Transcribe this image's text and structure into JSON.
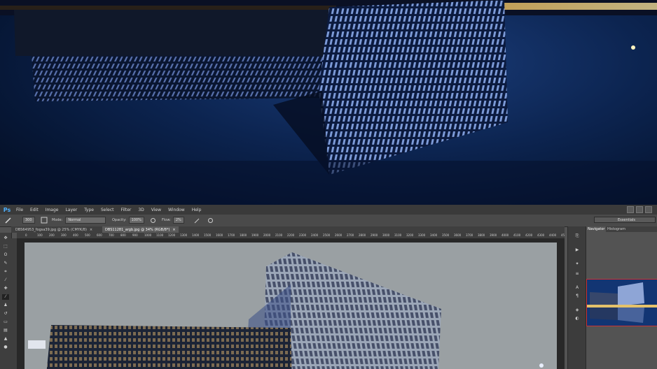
{
  "app": {
    "logo": "Ps",
    "menu": [
      "File",
      "Edit",
      "Image",
      "Layer",
      "Type",
      "Select",
      "Filter",
      "3D",
      "View",
      "Window",
      "Help"
    ]
  },
  "options_bar": {
    "brush_size": "300",
    "mode_label": "Mode:",
    "mode_value": "Normal",
    "opacity_label": "Opacity:",
    "opacity_value": "100%",
    "flow_label": "Flow:",
    "flow_value": "2%",
    "workspace": "Essentials"
  },
  "documents": {
    "tabs": [
      {
        "label": "DBS64953_fogsa39.jpg @ 25% (CMYK/8)",
        "active": false
      },
      {
        "label": "DBS11281_argb.jpg @ 34% (RGB/8*)",
        "active": true
      }
    ]
  },
  "ruler": {
    "ticks": [
      "0",
      "100",
      "200",
      "300",
      "400",
      "500",
      "600",
      "700",
      "800",
      "900",
      "1000",
      "1100",
      "1200",
      "1300",
      "1400",
      "1500",
      "1600",
      "1700",
      "1800",
      "1900",
      "2000",
      "2100",
      "2200",
      "2300",
      "2400",
      "2500",
      "2600",
      "2700",
      "2800",
      "2900",
      "3000",
      "3100",
      "3200",
      "3300",
      "3400",
      "3500",
      "3600",
      "3700",
      "3800",
      "3900",
      "4000",
      "4100",
      "4200",
      "4300",
      "4400",
      "4500"
    ]
  },
  "panels": {
    "tabs": [
      "Navigator",
      "Histogram"
    ]
  },
  "icons": {
    "tools": [
      "move-tool-icon",
      "marquee-tool-icon",
      "lasso-tool-icon",
      "quick-select-tool-icon",
      "crop-tool-icon",
      "eyedropper-tool-icon",
      "healing-brush-icon",
      "brush-tool-icon",
      "clone-stamp-icon",
      "history-brush-icon",
      "eraser-tool-icon",
      "gradient-tool-icon",
      "blur-tool-icon",
      "dodge-tool-icon"
    ],
    "dock": [
      "history-panel-icon",
      "actions-panel-icon",
      "brush-presets-icon",
      "adjustments-icon",
      "character-panel-icon",
      "paragraph-panel-icon",
      "layers-panel-icon",
      "channels-panel-icon"
    ]
  },
  "colors": {
    "accent": "#4db0ff",
    "highlight_frame": "#cc3333"
  }
}
